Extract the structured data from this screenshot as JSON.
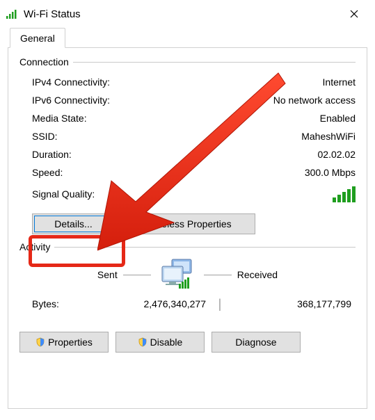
{
  "titlebar": {
    "title": "Wi-Fi Status"
  },
  "tabs": {
    "general": "General"
  },
  "groups": {
    "connection": "Connection",
    "activity": "Activity"
  },
  "connection": {
    "ipv4_label": "IPv4 Connectivity:",
    "ipv4_value": "Internet",
    "ipv6_label": "IPv6 Connectivity:",
    "ipv6_value": "No network access",
    "media_label": "Media State:",
    "media_value": "Enabled",
    "ssid_label": "SSID:",
    "ssid_value": "MaheshWiFi",
    "duration_label": "Duration:",
    "duration_value": "02.02.02",
    "speed_label": "Speed:",
    "speed_value": "300.0 Mbps",
    "signal_label": "Signal Quality:"
  },
  "buttons": {
    "details": "Details...",
    "wireless_properties": "Wireless Properties",
    "properties": "Properties",
    "disable": "Disable",
    "diagnose": "Diagnose"
  },
  "activity": {
    "sent_label": "Sent",
    "received_label": "Received",
    "bytes_label": "Bytes:",
    "bytes_sent": "2,476,340,277",
    "bytes_received": "368,177,799"
  }
}
